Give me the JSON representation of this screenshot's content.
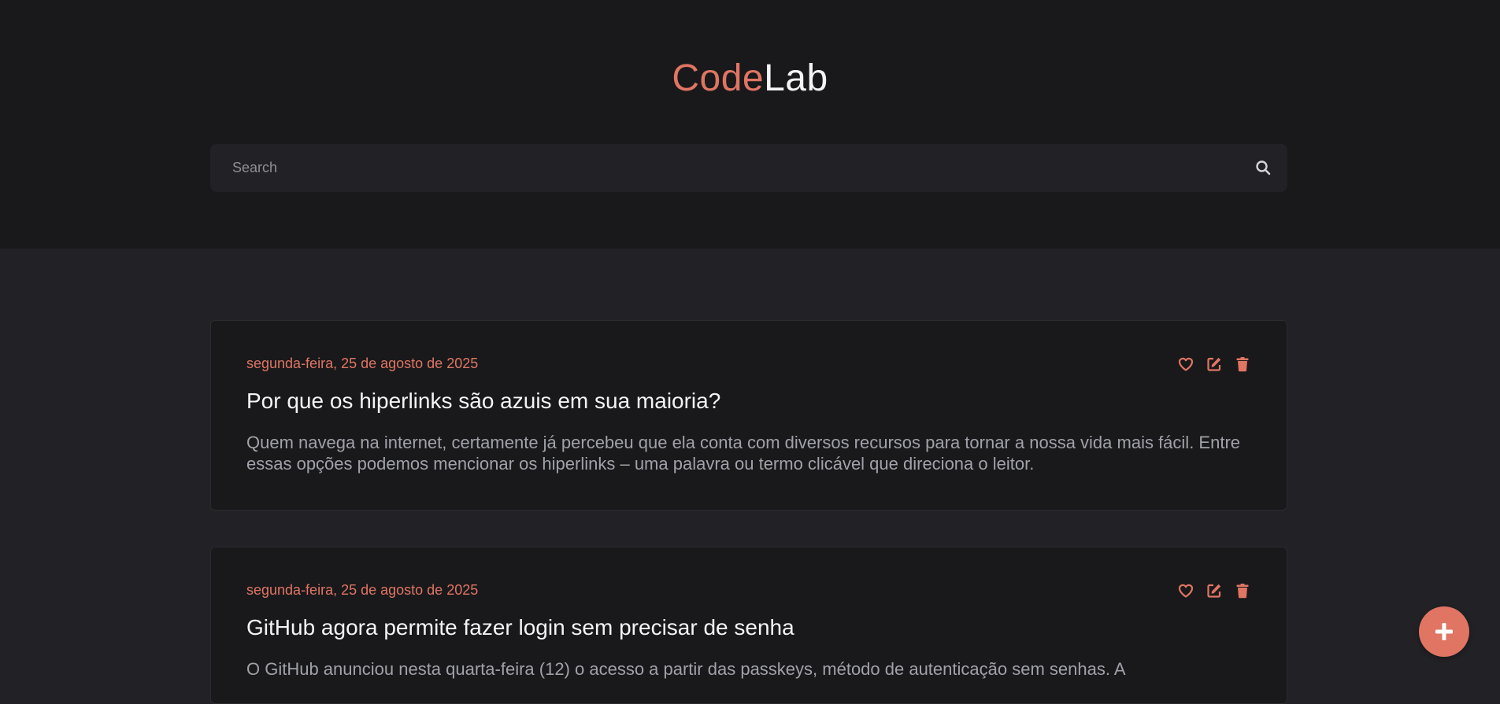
{
  "brand": {
    "part1": "Code",
    "part2": "Lab"
  },
  "search": {
    "placeholder": "Search",
    "value": "",
    "icon": "search-icon"
  },
  "posts": [
    {
      "date": "segunda-feira, 25 de agosto de 2025",
      "title": "Por que os hiperlinks são azuis em sua maioria?",
      "excerpt": "Quem navega na internet, certamente já percebeu que ela conta com diversos recursos para tornar a nossa vida mais fácil. Entre essas opções podemos mencionar os hiperlinks – uma palavra ou termo clicável que direciona o leitor."
    },
    {
      "date": "segunda-feira, 25 de agosto de 2025",
      "title": "GitHub agora permite fazer login sem precisar de senha",
      "excerpt": "O GitHub anunciou nesta quarta-feira (12) o acesso a partir das passkeys, método de autenticação sem senhas. A"
    }
  ],
  "actions": {
    "like_icon": "heart-icon",
    "edit_icon": "edit-icon",
    "delete_icon": "trash-icon"
  },
  "fab": {
    "icon": "plus-icon"
  },
  "colors": {
    "accent": "#e07563",
    "header_bg": "#19191b",
    "page_bg": "#222226",
    "card_bg": "#19191b"
  }
}
